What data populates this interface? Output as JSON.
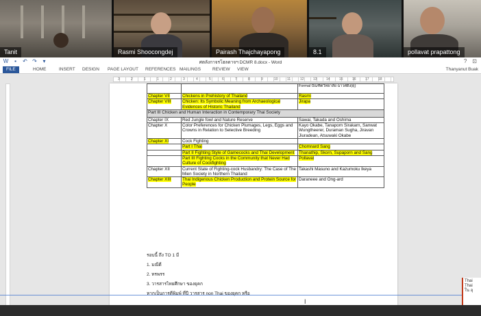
{
  "video_call": {
    "participants": [
      {
        "name": "Tanit"
      },
      {
        "name": "Rasmi Shoocongdej"
      },
      {
        "name": "Pairash Thajchayapong"
      },
      {
        "name": "8.1"
      },
      {
        "name": "pollavat prapattong"
      }
    ]
  },
  "word": {
    "title": "ศตลังกาจรโฮลดาจฯ DCMR 8.docx - Word",
    "tabs": [
      "FILE",
      "HOME",
      "INSERT",
      "DESIGN",
      "PAGE LAYOUT",
      "REFERENCES",
      "MAILINGS",
      "REVIEW",
      "VIEW"
    ],
    "user": "Thanyanut Buak",
    "window_controls": [
      "?",
      "⊡"
    ],
    "ruler_numbers": [
      "3",
      "2",
      "1",
      "1",
      "2",
      "3",
      "4",
      "5",
      "6",
      "7",
      "8",
      "9",
      "10",
      "11",
      "12",
      "13",
      "14",
      "15",
      "16",
      "17",
      "18"
    ],
    "table": {
      "top_fragment": "Formal บัณฑิตวิทยาลัย ฉาวศดิง(ดุ)",
      "rows": [
        {
          "c1": "Chapter VII",
          "c2": "Chickens in Prehistory of Thailand",
          "c3": "Rasmi",
          "hl1": true,
          "hl2": true,
          "hl3": true
        },
        {
          "c1": "Chapter VIII",
          "c2": "Chicken: Its Symbolic Meaning from Archaeological Evidences of Historic Thailand",
          "c3": "Jirapa",
          "hl1": true,
          "hl2": true,
          "hl3": true
        },
        {
          "part": "Part III Chicken and Human Interaction in Contemporary Thai Society"
        },
        {
          "c1": "Chapter IX",
          "c2": "Red Jungle fowl and Nature Reserve",
          "c3": "Sawai, Takada and Oshima"
        },
        {
          "c1": "Chapter X",
          "c2": "Color Preferences for Chicken Plumages, Legs, Eggs and Crowns in Relation to Selective Breeding",
          "c3": "Kayo Okabe, Tanaporn Sirakarn, Sanwat Wungtheerer, Duraman Sugha, Jiravan Jiuradean, Atsuwaki Okabe"
        },
        {
          "c1": "Chapter XI",
          "c2": "Cock Fighting",
          "c3": "",
          "hl1": true
        },
        {
          "c1": "",
          "c2": "Part I  Thai",
          "c3": "Chomnard Sang",
          "hl2": true,
          "hl3": true
        },
        {
          "c1": "",
          "c2": "Part II  Fighting Style of Gamecocks and Thai Development",
          "c3": "Thanathip, Skorn, Supaporn and Sang",
          "hl2": true,
          "hl3": true
        },
        {
          "c1": "",
          "c2": "Part III  Fighting Cocks in the Community that Never Had Culture of Cockfighting",
          "c3": "Pollavat",
          "hl2": true,
          "hl3": true
        },
        {
          "c1": "Chapter XII",
          "c2": "Current State of Fighting-cock Husbandry: The Case of The Mien Society in Northern Thailand",
          "c3": "Takashi Masuno and Kazumoku Ikeya"
        },
        {
          "c1": "Chapter XIII",
          "c2": "Thai Indigenous Chicken Production and Protein Source for People",
          "c3": "Daraneee and Ong-ard",
          "hl1": true,
          "hl2": true
        }
      ]
    },
    "lines_after": [
      "รอบนี้ ถึง TO 1 มี",
      "1. มณีดี",
      "2. ทรพรร",
      "3. วารสารไทยศึกษา ของยุคก",
      "หากเป็นการตีพิมพ์ ที่ปี วารสาร non Thai ของยุคก หรือ"
    ]
  },
  "notification": {
    "lines": [
      "Thai",
      "Thai",
      "ใน อุ"
    ]
  }
}
